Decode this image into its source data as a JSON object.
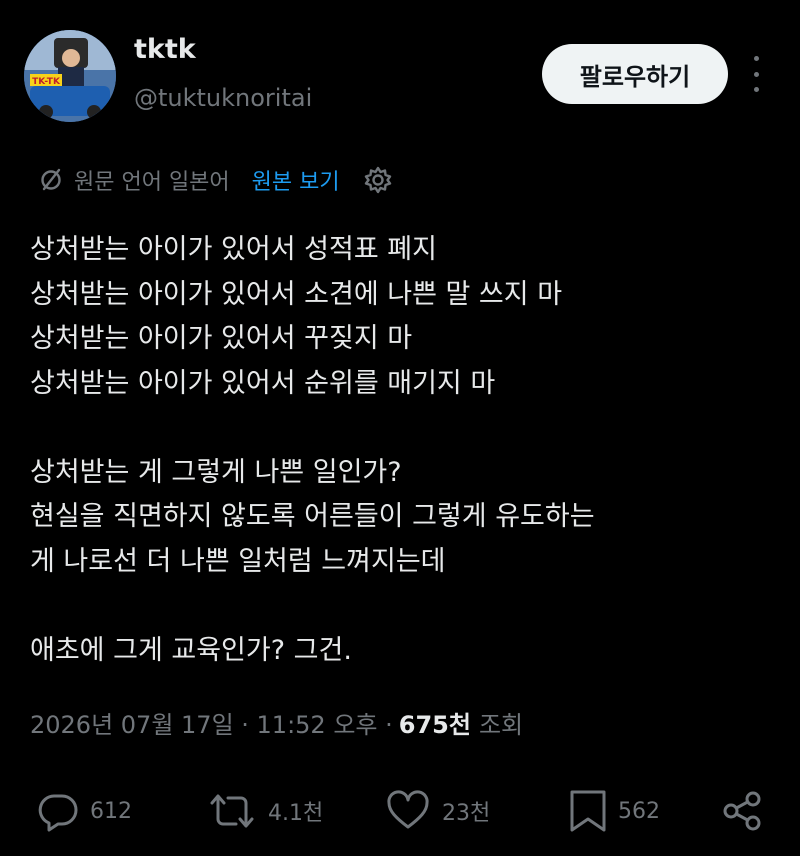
{
  "author": {
    "name": "tktk",
    "handle": "@tuktuknoritai",
    "avatar_badge": "TK-TK"
  },
  "header": {
    "follow_label": "팔로우하기"
  },
  "translation": {
    "source_label": "원문 언어 일본어",
    "view_original_label": "원본 보기"
  },
  "post": {
    "text": "상처받는 아이가 있어서 성적표 폐지\n상처받는 아이가 있어서 소견에 나쁜 말 쓰지 마\n상처받는 아이가 있어서 꾸짖지 마\n상처받는 아이가 있어서 순위를 매기지 마\n\n상처받는 게 그렇게 나쁜 일인가?\n현실을 직면하지 않도록 어른들이 그렇게 유도하는\n게 나로선 더 나쁜 일처럼 느껴지는데\n\n애초에 그게 교육인가? 그건.",
    "timestamp": "2026년 07월 17일 · 11:52 오후 ·",
    "views_count": "675천",
    "views_label": "조회"
  },
  "actions": {
    "replies": "612",
    "reposts": "4.1천",
    "likes": "23천",
    "bookmarks": "562"
  },
  "colors": {
    "background": "#000000",
    "text": "#e7e9ea",
    "muted": "#71767b",
    "link": "#1d9bf0",
    "button_bg": "#eff3f4"
  }
}
